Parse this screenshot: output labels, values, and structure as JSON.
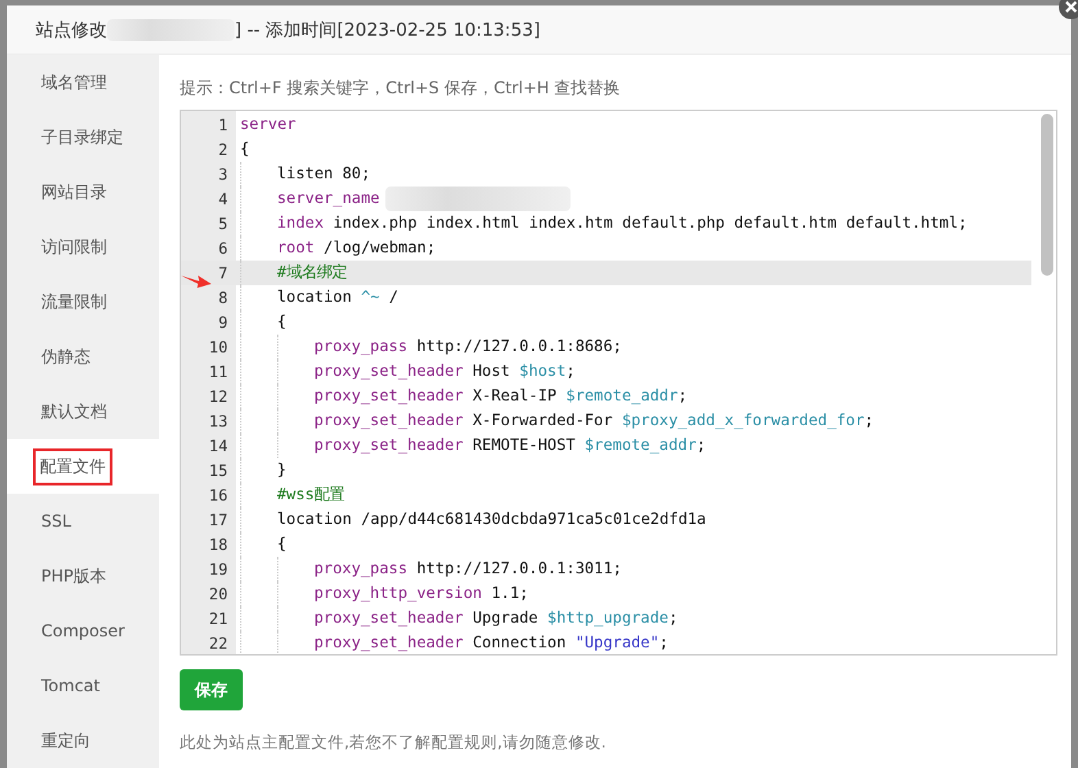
{
  "dialog": {
    "title_prefix": "站点修改",
    "title_suffix": "] -- 添加时间[2023-02-25 10:13:53]"
  },
  "sidebar": {
    "items": [
      {
        "label": "域名管理",
        "selected": false
      },
      {
        "label": "子目录绑定",
        "selected": false
      },
      {
        "label": "网站目录",
        "selected": false
      },
      {
        "label": "访问限制",
        "selected": false
      },
      {
        "label": "流量限制",
        "selected": false
      },
      {
        "label": "伪静态",
        "selected": false
      },
      {
        "label": "默认文档",
        "selected": false
      },
      {
        "label": "配置文件",
        "selected": true
      },
      {
        "label": "SSL",
        "selected": false
      },
      {
        "label": "PHP版本",
        "selected": false
      },
      {
        "label": "Composer",
        "selected": false
      },
      {
        "label": "Tomcat",
        "selected": false
      },
      {
        "label": "重定向",
        "selected": false
      }
    ]
  },
  "hint": "提示：Ctrl+F 搜索关键字，Ctrl+S 保存，Ctrl+H 查找替换",
  "editor": {
    "lines": [
      {
        "n": "1",
        "active": false,
        "tokens": [
          {
            "kind": "keyword",
            "text": "server"
          }
        ]
      },
      {
        "n": "2",
        "active": false,
        "tokens": [
          {
            "kind": "plain",
            "text": "{"
          }
        ],
        "children": [
          {
            "n": "3",
            "active": false,
            "tokens": [
              {
                "kind": "plain",
                "text": "listen 80;"
              }
            ]
          },
          {
            "n": "4",
            "active": false,
            "tokens": [
              {
                "kind": "keyword",
                "text": "server_name"
              },
              {
                "kind": "redacted"
              }
            ]
          },
          {
            "n": "5",
            "active": false,
            "tokens": [
              {
                "kind": "keyword",
                "text": "index"
              },
              {
                "kind": "plain",
                "text": " index.php index.html index.htm default.php default.htm default.html;"
              }
            ]
          },
          {
            "n": "6",
            "active": false,
            "tokens": [
              {
                "kind": "keyword",
                "text": "root"
              },
              {
                "kind": "plain",
                "text": " /log/webman;"
              }
            ]
          },
          {
            "n": "7",
            "active": true,
            "tokens": [
              {
                "kind": "comment",
                "text": "#域名绑定"
              }
            ]
          },
          {
            "n": "8",
            "active": false,
            "tokens": [
              {
                "kind": "plain",
                "text": "location "
              },
              {
                "kind": "var",
                "text": "^~"
              },
              {
                "kind": "plain",
                "text": " /"
              }
            ]
          },
          {
            "n": "9",
            "active": false,
            "tokens": [
              {
                "kind": "plain",
                "text": "{"
              }
            ],
            "children": [
              {
                "n": "10",
                "active": false,
                "tokens": [
                  {
                    "kind": "keyword",
                    "text": "proxy_pass"
                  },
                  {
                    "kind": "plain",
                    "text": " http://127.0.0.1:8686;"
                  }
                ]
              },
              {
                "n": "11",
                "active": false,
                "tokens": [
                  {
                    "kind": "keyword",
                    "text": "proxy_set_header"
                  },
                  {
                    "kind": "plain",
                    "text": " Host "
                  },
                  {
                    "kind": "var",
                    "text": "$host"
                  },
                  {
                    "kind": "plain",
                    "text": ";"
                  }
                ]
              },
              {
                "n": "12",
                "active": false,
                "tokens": [
                  {
                    "kind": "keyword",
                    "text": "proxy_set_header"
                  },
                  {
                    "kind": "plain",
                    "text": " X-Real-IP "
                  },
                  {
                    "kind": "var",
                    "text": "$remote_addr"
                  },
                  {
                    "kind": "plain",
                    "text": ";"
                  }
                ]
              },
              {
                "n": "13",
                "active": false,
                "tokens": [
                  {
                    "kind": "keyword",
                    "text": "proxy_set_header"
                  },
                  {
                    "kind": "plain",
                    "text": " X-Forwarded-For "
                  },
                  {
                    "kind": "var",
                    "text": "$proxy_add_x_forwarded_for"
                  },
                  {
                    "kind": "plain",
                    "text": ";"
                  }
                ]
              },
              {
                "n": "14",
                "active": false,
                "tokens": [
                  {
                    "kind": "keyword",
                    "text": "proxy_set_header"
                  },
                  {
                    "kind": "plain",
                    "text": " REMOTE-HOST "
                  },
                  {
                    "kind": "var",
                    "text": "$remote_addr"
                  },
                  {
                    "kind": "plain",
                    "text": ";"
                  }
                ]
              }
            ]
          },
          {
            "n": "15",
            "active": false,
            "tokens": [
              {
                "kind": "plain",
                "text": "}"
              }
            ]
          },
          {
            "n": "16",
            "active": false,
            "tokens": [
              {
                "kind": "comment",
                "text": "#wss配置"
              }
            ]
          },
          {
            "n": "17",
            "active": false,
            "tokens": [
              {
                "kind": "plain",
                "text": "location /app/d44c681430dcbda971ca5c01ce2dfd1a"
              }
            ]
          },
          {
            "n": "18",
            "active": false,
            "tokens": [
              {
                "kind": "plain",
                "text": "{"
              }
            ],
            "children": [
              {
                "n": "19",
                "active": false,
                "tokens": [
                  {
                    "kind": "keyword",
                    "text": "proxy_pass"
                  },
                  {
                    "kind": "plain",
                    "text": " http://127.0.0.1:3011;"
                  }
                ]
              },
              {
                "n": "20",
                "active": false,
                "tokens": [
                  {
                    "kind": "keyword",
                    "text": "proxy_http_version"
                  },
                  {
                    "kind": "plain",
                    "text": " 1.1;"
                  }
                ]
              },
              {
                "n": "21",
                "active": false,
                "tokens": [
                  {
                    "kind": "keyword",
                    "text": "proxy_set_header"
                  },
                  {
                    "kind": "plain",
                    "text": " Upgrade "
                  },
                  {
                    "kind": "var",
                    "text": "$http_upgrade"
                  },
                  {
                    "kind": "plain",
                    "text": ";"
                  }
                ]
              },
              {
                "n": "22",
                "active": false,
                "tokens": [
                  {
                    "kind": "keyword",
                    "text": "proxy_set_header"
                  },
                  {
                    "kind": "plain",
                    "text": " Connection "
                  },
                  {
                    "kind": "string",
                    "text": "\"Upgrade\""
                  },
                  {
                    "kind": "plain",
                    "text": ";"
                  }
                ]
              }
            ]
          }
        ]
      }
    ]
  },
  "save_button": "保存",
  "note": "此处为站点主配置文件,若您不了解配置规则,请勿随意修改."
}
